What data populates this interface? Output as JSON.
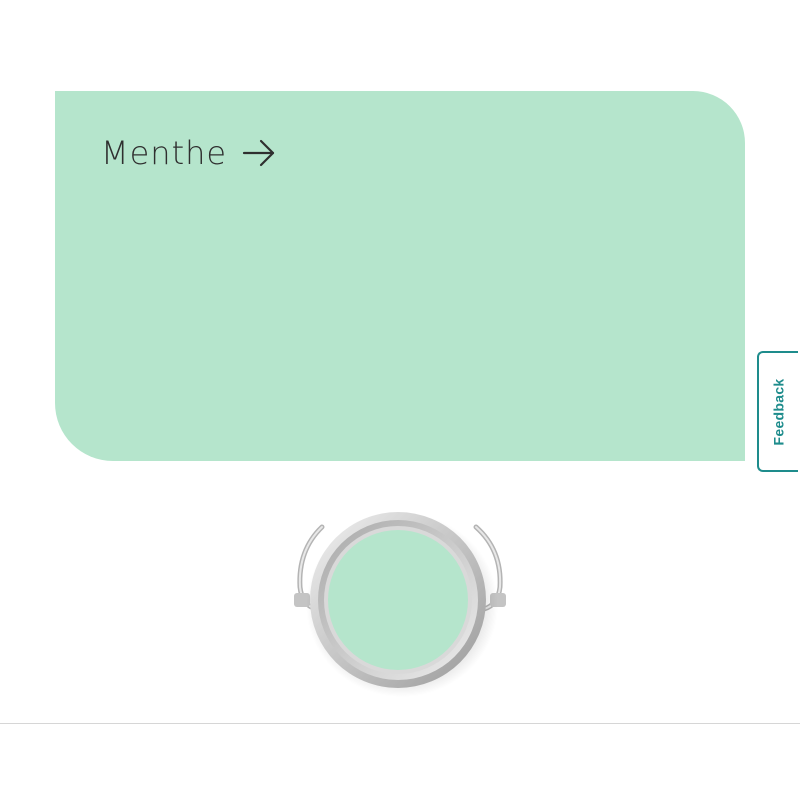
{
  "colour_card": {
    "name": "Menthe",
    "colour_hex": "#b5e5cc"
  },
  "feedback": {
    "label": "Feedback",
    "accent_color": "#1e8c8c"
  },
  "paint_tin": {
    "icon": "paint-can-icon",
    "paint_color": "#b5e5cc"
  },
  "icons": {
    "link_arrow": "arrow-right-icon"
  }
}
